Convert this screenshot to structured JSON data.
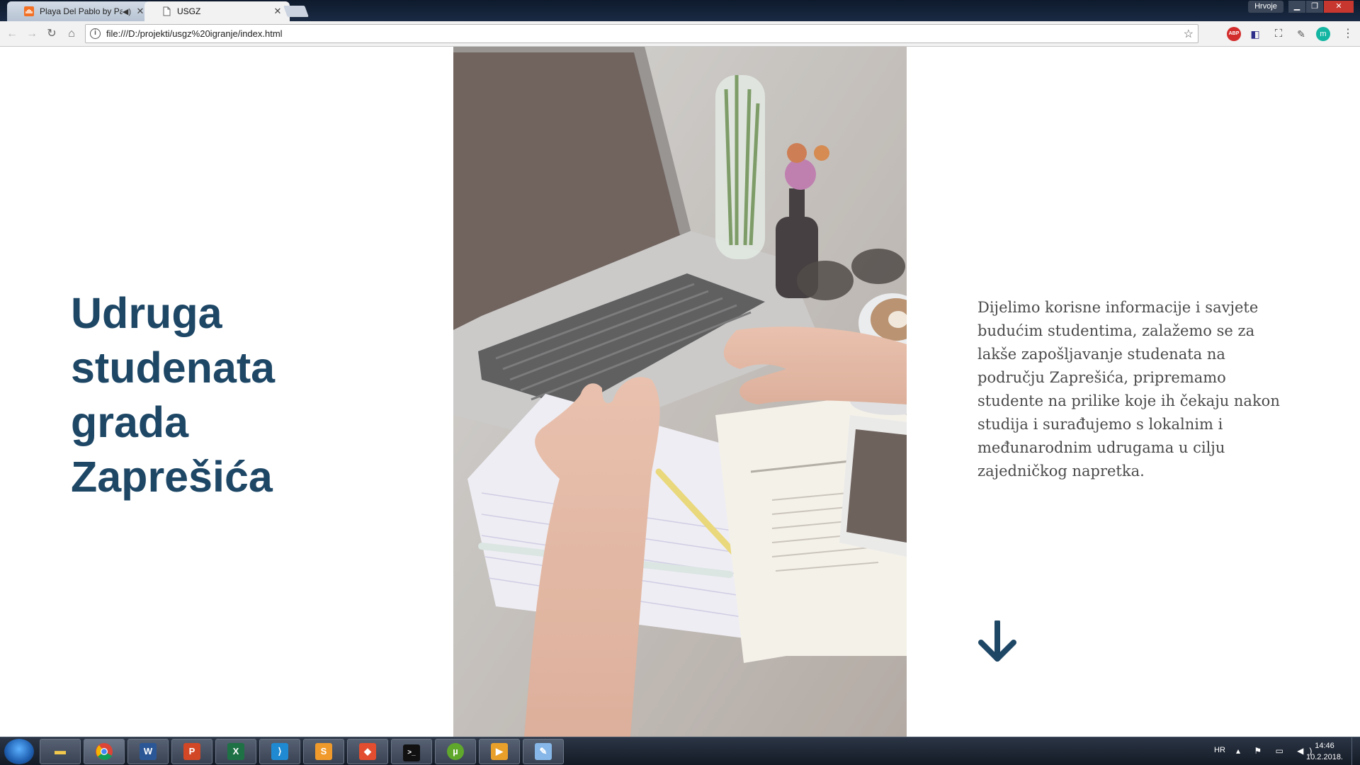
{
  "browser": {
    "tabs": [
      {
        "title": "Playa Del Pablo by Pa",
        "favicon": "soundcloud-icon",
        "muted_icon": "speaker-icon",
        "active": false
      },
      {
        "title": "USGZ",
        "favicon": "page-icon",
        "active": true
      }
    ],
    "profile_name": "Hrvoje",
    "url": "file:///D:/projekti/usgz%20igranje/index.html",
    "close_glyph": "✕",
    "extensions": [
      "adblock-plus-icon",
      "extension-icon",
      "screenshot-icon",
      "eyedropper-icon",
      "m-extension-icon",
      "menu-icon"
    ],
    "abp_label": "ABP",
    "ext5_label": "m"
  },
  "page": {
    "heading": "Udruga studenata grada Zaprešića",
    "description": "Dijelimo korisne informacije i savjete budućim studentima, zalažemo se za lakše zapošljavanje studenata na području Zaprešića, pripremamo studente na prilike koje ih čekaju nakon studija i surađujemo s lokalnim i međunarodnim udrugama u cilju zajedničkog napretka.",
    "accent_color": "#1e4766",
    "photo_icon": "laptop-desk-photo",
    "scroll_icon": "arrow-down-icon"
  },
  "taskbar": {
    "apps": [
      "file-explorer-icon",
      "chrome-icon",
      "word-icon",
      "powerpoint-icon",
      "excel-icon",
      "vscode-icon",
      "sublime-text-icon",
      "git-icon",
      "terminal-icon",
      "utorrent-icon",
      "media-player-icon",
      "paint-icon"
    ],
    "language": "HR",
    "time": "14:46",
    "date": "10.2.2018."
  }
}
